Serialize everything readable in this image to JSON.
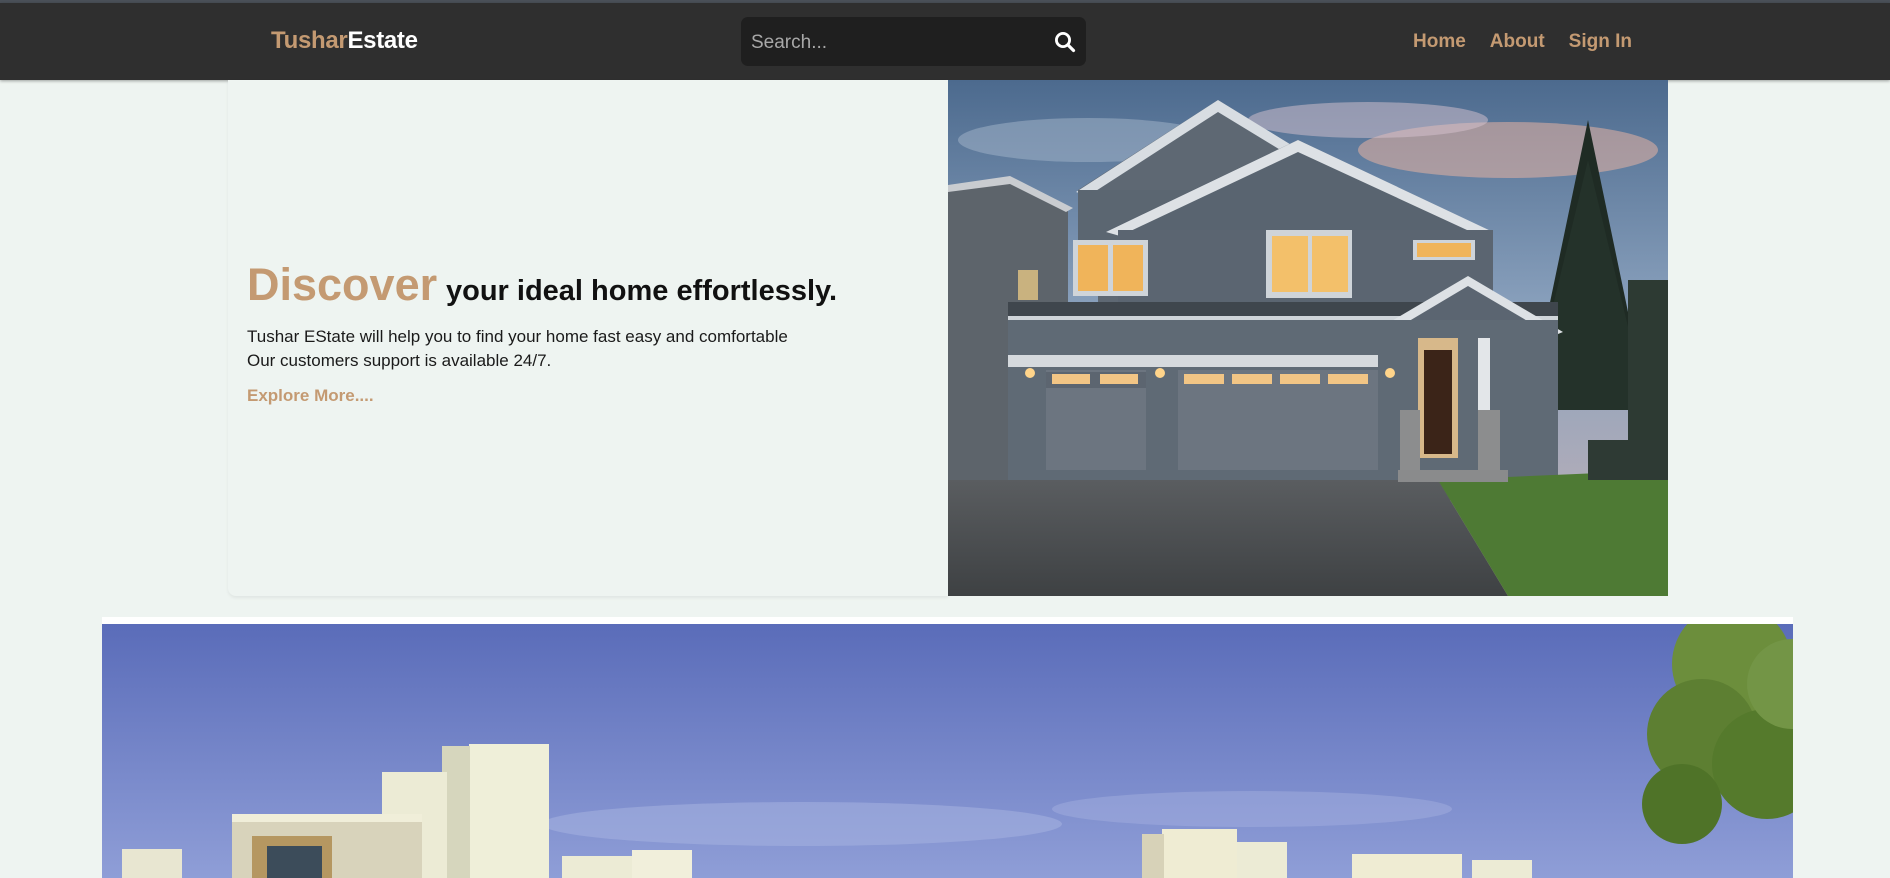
{
  "header": {
    "logo_part1": "Tushar",
    "logo_part2": "Estate",
    "search_placeholder": "Search...",
    "search_icon": "search-icon",
    "nav": [
      {
        "label": "Home"
      },
      {
        "label": "About"
      },
      {
        "label": "Sign In"
      }
    ]
  },
  "hero": {
    "headline_highlight": "Discover",
    "headline_rest": "your ideal home effortlessly.",
    "description_line1": "Tushar EState will help you to find your home fast easy and comfortable",
    "description_line2": "Our customers support is available 24/7.",
    "explore_link": "Explore More...."
  },
  "colors": {
    "accent": "#c49a72",
    "navbar_bg": "#2f2f2f",
    "page_bg": "#eef4f1"
  }
}
